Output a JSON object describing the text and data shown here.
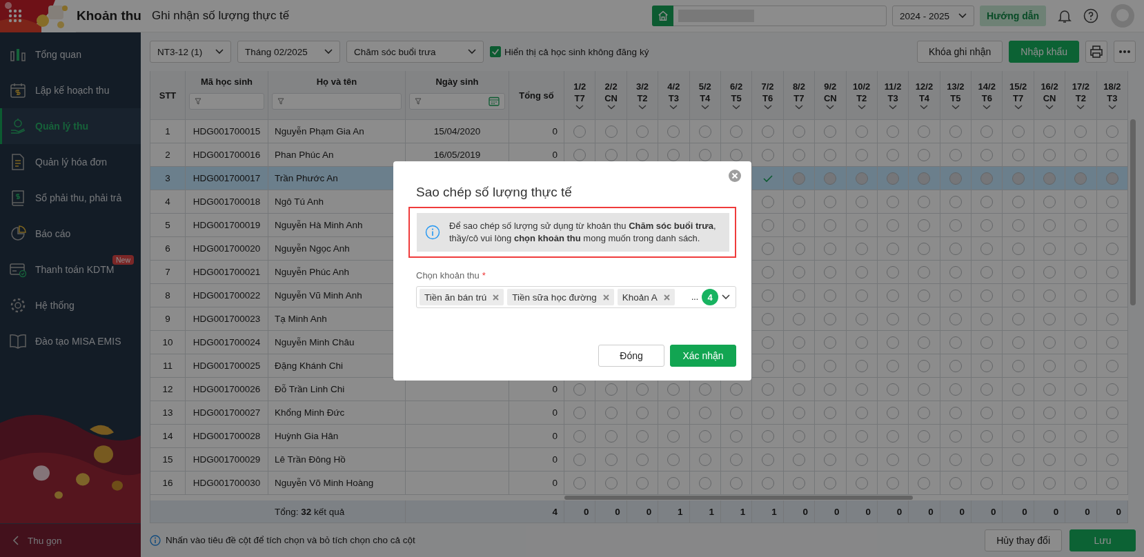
{
  "app": {
    "title": "Khoản thu",
    "page_title": "Ghi nhận số lượng thực tế"
  },
  "header": {
    "school_year": "2024 - 2025",
    "guide_button": "Hướng dẫn"
  },
  "sidebar": {
    "items": [
      {
        "label": "Tổng quan",
        "selected": false
      },
      {
        "label": "Lập kế hoạch thu",
        "selected": false
      },
      {
        "label": "Quản lý thu",
        "selected": true
      },
      {
        "label": "Quản lý hóa đơn",
        "selected": false
      },
      {
        "label": "Sổ phải thu, phải trả",
        "selected": false
      },
      {
        "label": "Báo cáo",
        "selected": false
      },
      {
        "label": "Thanh toán KDTM",
        "selected": false,
        "badge": "New"
      },
      {
        "label": "Hệ thống",
        "selected": false
      },
      {
        "label": "Đào tạo MISA EMIS",
        "selected": false
      }
    ],
    "collapse": "Thu gọn"
  },
  "toolbar": {
    "class_select": "NT3-12 (1)",
    "month_select": "Tháng 02/2025",
    "fee_select": "Chăm sóc buổi trưa",
    "show_unregistered": {
      "label": "Hiển thị cả học sinh không đăng ký",
      "checked": true
    },
    "lock_button": "Khóa ghi nhận",
    "import_button": "Nhập khẩu"
  },
  "table": {
    "columns": {
      "stt": "STT",
      "code": "Mã học sinh",
      "name": "Họ và tên",
      "dob": "Ngày sinh",
      "total": "Tổng số"
    },
    "days": [
      {
        "date": "1/2",
        "weekday": "T7"
      },
      {
        "date": "2/2",
        "weekday": "CN"
      },
      {
        "date": "3/2",
        "weekday": "T2"
      },
      {
        "date": "4/2",
        "weekday": "T3"
      },
      {
        "date": "5/2",
        "weekday": "T4"
      },
      {
        "date": "6/2",
        "weekday": "T5"
      },
      {
        "date": "7/2",
        "weekday": "T6"
      },
      {
        "date": "8/2",
        "weekday": "T7"
      },
      {
        "date": "9/2",
        "weekday": "CN"
      },
      {
        "date": "10/2",
        "weekday": "T2"
      },
      {
        "date": "11/2",
        "weekday": "T3"
      },
      {
        "date": "12/2",
        "weekday": "T4"
      },
      {
        "date": "13/2",
        "weekday": "T5"
      },
      {
        "date": "14/2",
        "weekday": "T6"
      },
      {
        "date": "15/2",
        "weekday": "T7"
      },
      {
        "date": "16/2",
        "weekday": "CN"
      },
      {
        "date": "17/2",
        "weekday": "T2"
      },
      {
        "date": "18/2",
        "weekday": "T3"
      }
    ],
    "rows": [
      {
        "stt": "1",
        "code": "HDG001700015",
        "name": "Nguyễn Phạm Gia An",
        "dob": "15/04/2020",
        "total": "0",
        "selected": false,
        "days": [
          {
            "checked": false,
            "disabled": false
          },
          {
            "checked": false,
            "disabled": false
          },
          {
            "checked": false,
            "disabled": false
          },
          {
            "checked": false,
            "disabled": false
          },
          {
            "checked": false,
            "disabled": false
          },
          {
            "checked": false,
            "disabled": false
          },
          {
            "checked": false,
            "disabled": false
          },
          {
            "checked": false,
            "disabled": false
          },
          {
            "checked": false,
            "disabled": false
          },
          {
            "checked": false,
            "disabled": false
          },
          {
            "checked": false,
            "disabled": false
          },
          {
            "checked": false,
            "disabled": false
          },
          {
            "checked": false,
            "disabled": false
          },
          {
            "checked": false,
            "disabled": false
          },
          {
            "checked": false,
            "disabled": false
          },
          {
            "checked": false,
            "disabled": false
          },
          {
            "checked": false,
            "disabled": false
          },
          {
            "checked": false,
            "disabled": false
          }
        ]
      },
      {
        "stt": "2",
        "code": "HDG001700016",
        "name": "Phan Phúc An",
        "dob": "16/05/2019",
        "total": "0",
        "selected": false,
        "days": [
          {
            "checked": false,
            "disabled": false
          },
          {
            "checked": false,
            "disabled": false
          },
          {
            "checked": false,
            "disabled": false
          },
          {
            "checked": false,
            "disabled": false
          },
          {
            "checked": false,
            "disabled": false
          },
          {
            "checked": false,
            "disabled": false
          },
          {
            "checked": false,
            "disabled": false
          },
          {
            "checked": false,
            "disabled": false
          },
          {
            "checked": false,
            "disabled": false
          },
          {
            "checked": false,
            "disabled": false
          },
          {
            "checked": false,
            "disabled": false
          },
          {
            "checked": false,
            "disabled": false
          },
          {
            "checked": false,
            "disabled": false
          },
          {
            "checked": false,
            "disabled": false
          },
          {
            "checked": false,
            "disabled": false
          },
          {
            "checked": false,
            "disabled": false
          },
          {
            "checked": false,
            "disabled": false
          },
          {
            "checked": false,
            "disabled": false
          }
        ]
      },
      {
        "stt": "3",
        "code": "HDG001700017",
        "name": "Trần Phước An",
        "selected": true,
        "days": [
          {
            "checked": true,
            "disabled": false
          },
          {
            "checked": false,
            "disabled": true
          },
          {
            "checked": false,
            "disabled": true
          },
          {
            "checked": false,
            "disabled": true
          },
          {
            "checked": false,
            "disabled": true
          },
          {
            "checked": false,
            "disabled": true
          },
          {
            "checked": false,
            "disabled": true
          },
          {
            "checked": false,
            "disabled": true
          },
          {
            "checked": false,
            "disabled": true
          },
          {
            "checked": false,
            "disabled": true
          },
          {
            "checked": false,
            "disabled": true
          },
          {
            "checked": false,
            "disabled": true
          }
        ]
      },
      {
        "stt": "4",
        "code": "HDG001700018",
        "name": "Ngô Tú Anh",
        "selected": false,
        "days": [
          {
            "checked": false,
            "disabled": false
          },
          {
            "checked": false,
            "disabled": false
          },
          {
            "checked": false,
            "disabled": false
          },
          {
            "checked": false,
            "disabled": false
          },
          {
            "checked": false,
            "disabled": false
          },
          {
            "checked": false,
            "disabled": false
          },
          {
            "checked": false,
            "disabled": false
          },
          {
            "checked": false,
            "disabled": false
          },
          {
            "checked": false,
            "disabled": false
          },
          {
            "checked": false,
            "disabled": false
          },
          {
            "checked": false,
            "disabled": false
          },
          {
            "checked": false,
            "disabled": false
          }
        ]
      },
      {
        "stt": "5",
        "code": "HDG001700019",
        "name": "Nguyễn Hà Minh Anh",
        "selected": false,
        "days": [
          {
            "checked": false,
            "disabled": false
          },
          {
            "checked": false,
            "disabled": false
          },
          {
            "checked": false,
            "disabled": false
          },
          {
            "checked": false,
            "disabled": false
          },
          {
            "checked": false,
            "disabled": false
          },
          {
            "checked": false,
            "disabled": false
          },
          {
            "checked": false,
            "disabled": false
          },
          {
            "checked": false,
            "disabled": false
          },
          {
            "checked": false,
            "disabled": false
          },
          {
            "checked": false,
            "disabled": false
          },
          {
            "checked": false,
            "disabled": false
          },
          {
            "checked": false,
            "disabled": false
          }
        ]
      },
      {
        "stt": "6",
        "code": "HDG001700020",
        "name": "Nguyễn Ngọc Anh",
        "selected": false,
        "days": [
          {
            "checked": false,
            "disabled": false
          },
          {
            "checked": false,
            "disabled": false
          },
          {
            "checked": false,
            "disabled": false
          },
          {
            "checked": false,
            "disabled": false
          },
          {
            "checked": false,
            "disabled": false
          },
          {
            "checked": false,
            "disabled": false
          },
          {
            "checked": false,
            "disabled": false
          },
          {
            "checked": false,
            "disabled": false
          },
          {
            "checked": false,
            "disabled": false
          },
          {
            "checked": false,
            "disabled": false
          },
          {
            "checked": false,
            "disabled": false
          },
          {
            "checked": false,
            "disabled": false
          }
        ]
      },
      {
        "stt": "7",
        "code": "HDG001700021",
        "name": "Nguyễn Phúc Anh",
        "selected": false,
        "days": [
          {
            "checked": false,
            "disabled": false
          },
          {
            "checked": false,
            "disabled": false
          },
          {
            "checked": false,
            "disabled": false
          },
          {
            "checked": false,
            "disabled": false
          },
          {
            "checked": false,
            "disabled": false
          },
          {
            "checked": false,
            "disabled": false
          },
          {
            "checked": false,
            "disabled": false
          },
          {
            "checked": false,
            "disabled": false
          },
          {
            "checked": false,
            "disabled": false
          },
          {
            "checked": false,
            "disabled": false
          },
          {
            "checked": false,
            "disabled": false
          },
          {
            "checked": false,
            "disabled": false
          }
        ]
      },
      {
        "stt": "8",
        "code": "HDG001700022",
        "name": "Nguyễn Vũ Minh Anh",
        "selected": false,
        "days": [
          {
            "checked": false,
            "disabled": false
          },
          {
            "checked": false,
            "disabled": false
          },
          {
            "checked": false,
            "disabled": false
          },
          {
            "checked": false,
            "disabled": false
          },
          {
            "checked": false,
            "disabled": false
          },
          {
            "checked": false,
            "disabled": false
          },
          {
            "checked": false,
            "disabled": false
          },
          {
            "checked": false,
            "disabled": false
          },
          {
            "checked": false,
            "disabled": false
          },
          {
            "checked": false,
            "disabled": false
          },
          {
            "checked": false,
            "disabled": false
          },
          {
            "checked": false,
            "disabled": false
          }
        ]
      },
      {
        "stt": "9",
        "code": "HDG001700023",
        "name": "Tạ Minh Anh",
        "selected": false,
        "days": [
          {
            "checked": false,
            "disabled": false
          },
          {
            "checked": false,
            "disabled": false
          },
          {
            "checked": false,
            "disabled": false
          },
          {
            "checked": false,
            "disabled": false
          },
          {
            "checked": false,
            "disabled": false
          },
          {
            "checked": false,
            "disabled": false
          },
          {
            "checked": false,
            "disabled": false
          },
          {
            "checked": false,
            "disabled": false
          },
          {
            "checked": false,
            "disabled": false
          },
          {
            "checked": false,
            "disabled": false
          },
          {
            "checked": false,
            "disabled": false
          },
          {
            "checked": false,
            "disabled": false
          }
        ]
      },
      {
        "stt": "10",
        "code": "HDG001700024",
        "name": "Nguyễn Minh Châu",
        "selected": false,
        "days": [
          {
            "checked": false,
            "disabled": false
          },
          {
            "checked": false,
            "disabled": false
          },
          {
            "checked": false,
            "disabled": false
          },
          {
            "checked": false,
            "disabled": false
          },
          {
            "checked": false,
            "disabled": false
          },
          {
            "checked": false,
            "disabled": false
          },
          {
            "checked": false,
            "disabled": false
          },
          {
            "checked": false,
            "disabled": false
          },
          {
            "checked": false,
            "disabled": false
          },
          {
            "checked": false,
            "disabled": false
          },
          {
            "checked": false,
            "disabled": false
          },
          {
            "checked": false,
            "disabled": false
          }
        ]
      },
      {
        "stt": "11",
        "code": "HDG001700025",
        "name": "Đặng Khánh Chi",
        "selected": false,
        "days": [
          {
            "checked": false,
            "disabled": false
          },
          {
            "checked": false,
            "disabled": false
          },
          {
            "checked": false,
            "disabled": false
          },
          {
            "checked": false,
            "disabled": false
          },
          {
            "checked": false,
            "disabled": false
          },
          {
            "checked": false,
            "disabled": false
          },
          {
            "checked": false,
            "disabled": false
          },
          {
            "checked": false,
            "disabled": false
          },
          {
            "checked": false,
            "disabled": false
          },
          {
            "checked": false,
            "disabled": false
          },
          {
            "checked": false,
            "disabled": false
          },
          {
            "checked": false,
            "disabled": false
          }
        ]
      },
      {
        "stt": "12",
        "code": "HDG001700026",
        "name": "Đỗ Trần Linh Chi",
        "total": "0",
        "selected": false,
        "days": [
          {
            "checked": false,
            "disabled": false
          },
          {
            "checked": false,
            "disabled": false
          },
          {
            "checked": false,
            "disabled": false
          },
          {
            "checked": false,
            "disabled": false
          },
          {
            "checked": false,
            "disabled": false
          },
          {
            "checked": false,
            "disabled": false
          },
          {
            "checked": false,
            "disabled": false
          },
          {
            "checked": false,
            "disabled": false
          },
          {
            "checked": false,
            "disabled": false
          },
          {
            "checked": false,
            "disabled": false
          },
          {
            "checked": false,
            "disabled": false
          },
          {
            "checked": false,
            "disabled": false
          },
          {
            "checked": false,
            "disabled": false
          },
          {
            "checked": false,
            "disabled": false
          },
          {
            "checked": false,
            "disabled": false
          },
          {
            "checked": false,
            "disabled": false
          },
          {
            "checked": false,
            "disabled": false
          },
          {
            "checked": false,
            "disabled": false
          }
        ]
      },
      {
        "stt": "13",
        "code": "HDG001700027",
        "name": "Khổng Minh Đức",
        "total": "0",
        "selected": false,
        "days": [
          {
            "checked": false,
            "disabled": false
          },
          {
            "checked": false,
            "disabled": false
          },
          {
            "checked": false,
            "disabled": false
          },
          {
            "checked": false,
            "disabled": false
          },
          {
            "checked": false,
            "disabled": false
          },
          {
            "checked": false,
            "disabled": false
          },
          {
            "checked": false,
            "disabled": false
          },
          {
            "checked": false,
            "disabled": false
          },
          {
            "checked": false,
            "disabled": false
          },
          {
            "checked": false,
            "disabled": false
          },
          {
            "checked": false,
            "disabled": false
          },
          {
            "checked": false,
            "disabled": false
          },
          {
            "checked": false,
            "disabled": false
          },
          {
            "checked": false,
            "disabled": false
          },
          {
            "checked": false,
            "disabled": false
          },
          {
            "checked": false,
            "disabled": false
          },
          {
            "checked": false,
            "disabled": false
          },
          {
            "checked": false,
            "disabled": false
          }
        ]
      },
      {
        "stt": "14",
        "code": "HDG001700028",
        "name": "Huỳnh Gia Hân",
        "total": "0",
        "selected": false,
        "days": [
          {
            "checked": false,
            "disabled": false
          },
          {
            "checked": false,
            "disabled": false
          },
          {
            "checked": false,
            "disabled": false
          },
          {
            "checked": false,
            "disabled": false
          },
          {
            "checked": false,
            "disabled": false
          },
          {
            "checked": false,
            "disabled": false
          },
          {
            "checked": false,
            "disabled": false
          },
          {
            "checked": false,
            "disabled": false
          },
          {
            "checked": false,
            "disabled": false
          },
          {
            "checked": false,
            "disabled": false
          },
          {
            "checked": false,
            "disabled": false
          },
          {
            "checked": false,
            "disabled": false
          },
          {
            "checked": false,
            "disabled": false
          },
          {
            "checked": false,
            "disabled": false
          },
          {
            "checked": false,
            "disabled": false
          },
          {
            "checked": false,
            "disabled": false
          },
          {
            "checked": false,
            "disabled": false
          },
          {
            "checked": false,
            "disabled": false
          }
        ]
      },
      {
        "stt": "15",
        "code": "HDG001700029",
        "name": "Lê Trần Đông Hồ",
        "total": "0",
        "selected": false,
        "days": [
          {
            "checked": false,
            "disabled": false
          },
          {
            "checked": false,
            "disabled": false
          },
          {
            "checked": false,
            "disabled": false
          },
          {
            "checked": false,
            "disabled": false
          },
          {
            "checked": false,
            "disabled": false
          },
          {
            "checked": false,
            "disabled": false
          },
          {
            "checked": false,
            "disabled": false
          },
          {
            "checked": false,
            "disabled": false
          },
          {
            "checked": false,
            "disabled": false
          },
          {
            "checked": false,
            "disabled": false
          },
          {
            "checked": false,
            "disabled": false
          },
          {
            "checked": false,
            "disabled": false
          },
          {
            "checked": false,
            "disabled": false
          },
          {
            "checked": false,
            "disabled": false
          },
          {
            "checked": false,
            "disabled": false
          },
          {
            "checked": false,
            "disabled": false
          },
          {
            "checked": false,
            "disabled": false
          },
          {
            "checked": false,
            "disabled": false
          }
        ]
      },
      {
        "stt": "16",
        "code": "HDG001700030",
        "name": "Nguyễn Võ Minh Hoàng",
        "total": "0",
        "selected": false,
        "days": [
          {
            "checked": false,
            "disabled": false
          },
          {
            "checked": false,
            "disabled": false
          },
          {
            "checked": false,
            "disabled": false
          },
          {
            "checked": false,
            "disabled": false
          },
          {
            "checked": false,
            "disabled": false
          },
          {
            "checked": false,
            "disabled": false
          },
          {
            "checked": false,
            "disabled": false
          },
          {
            "checked": false,
            "disabled": false
          },
          {
            "checked": false,
            "disabled": false
          },
          {
            "checked": false,
            "disabled": false
          },
          {
            "checked": false,
            "disabled": false
          },
          {
            "checked": false,
            "disabled": false
          },
          {
            "checked": false,
            "disabled": false
          },
          {
            "checked": false,
            "disabled": false
          },
          {
            "checked": false,
            "disabled": false
          },
          {
            "checked": false,
            "disabled": false
          },
          {
            "checked": false,
            "disabled": false
          },
          {
            "checked": false,
            "disabled": false
          }
        ]
      }
    ],
    "summary": {
      "label": "Tổng: **32** kết quả",
      "total": "4",
      "days": [
        "0",
        "0",
        "0",
        "1",
        "1",
        "1",
        "1",
        "0",
        "0",
        "0",
        "0",
        "0",
        "0",
        "0",
        "0",
        "0",
        "0",
        "0"
      ]
    }
  },
  "footer": {
    "hint": "Nhấn vào tiêu đề cột để tích chọn và bỏ tích chọn cho cả cột",
    "cancel_button": "Hủy thay đổi",
    "save_button": "Lưu"
  },
  "dialog": {
    "title": "Sao chép số lượng thực tế",
    "notice": "Để sao chép số lượng sử dụng từ khoản thu **Chăm sóc buổi trưa**, thầy/cô vui lòng **chọn khoản thu** mong muốn trong danh sách.",
    "field_label": "Chọn khoản thu",
    "required_mark": "*",
    "tags": [
      "Tiền ăn bán trú",
      "Tiền sữa học đường",
      "Khoản A"
    ],
    "more": "...",
    "count": "4",
    "close_button": "Đóng",
    "confirm_button": "Xác nhận"
  }
}
